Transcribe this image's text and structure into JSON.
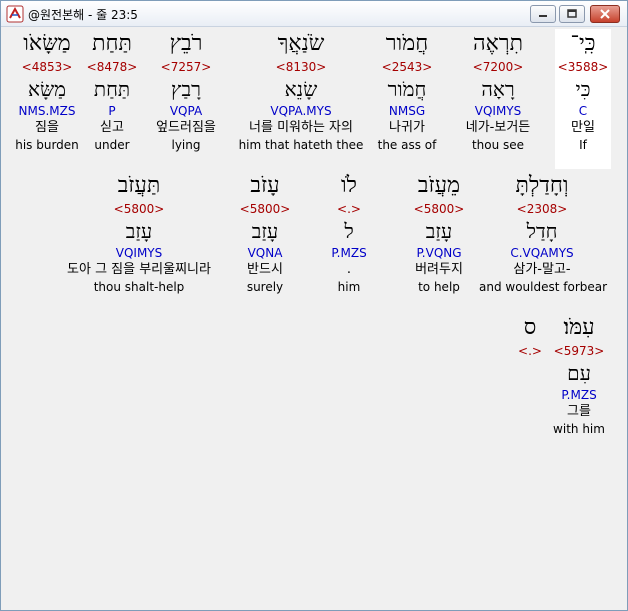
{
  "window": {
    "title": "@원전본해 - 줄 23:5"
  },
  "rows": [
    {
      "words": [
        {
          "hebrew": "כִּֽי־",
          "strongs": "<3588>",
          "root": "כִּי",
          "parse": "C",
          "korean": "만일",
          "english": "If",
          "highlight": true
        },
        {
          "hebrew": "תִרְאֶה",
          "strongs": "<7200>",
          "root": "רָאָה",
          "parse": "VQIMYS",
          "korean": "네가-보거든",
          "english": "thou see",
          "highlight": false
        },
        {
          "hebrew": "חֲמֹור",
          "strongs": "<2543>",
          "root": "חֲמֹור",
          "parse": "NMSG",
          "korean": "나귀가",
          "english": "the ass of",
          "highlight": false
        },
        {
          "hebrew": "שֹׂנַאֲךָ",
          "strongs": "<8130>",
          "root": "שָׂנֵא",
          "parse": "VQPA.MYS",
          "korean": "너를 미워하는 자의",
          "english": "him that hateth thee",
          "highlight": false
        },
        {
          "hebrew": "רֹבֵץ",
          "strongs": "<7257>",
          "root": "רָבַץ",
          "parse": "VQPA",
          "korean": "엎드러짐을",
          "english": "lying",
          "highlight": false
        },
        {
          "hebrew": "תַּחַת",
          "strongs": "<8478>",
          "root": "תַּחַת",
          "parse": "P",
          "korean": "싣고",
          "english": "under",
          "highlight": false
        },
        {
          "hebrew": "מַשָּׂאֹו",
          "strongs": "<4853>",
          "root": "מַשָּׂא",
          "parse": "NMS.MZS",
          "korean": "짐을",
          "english": "his burden",
          "highlight": false
        }
      ]
    },
    {
      "words": [
        {
          "hebrew": "וְחָדַלְתָּ",
          "strongs": "<2308>",
          "root": "חָדַל",
          "parse": "C.VQAMYS",
          "korean": "삼가-말고-",
          "english": "and wouldest forbear",
          "highlight": false
        },
        {
          "hebrew": "מֵעֲזֹב",
          "strongs": "<5800>",
          "root": "עָזַב",
          "parse": "P.VQNG",
          "korean": "버려두지",
          "english": "to help",
          "highlight": false
        },
        {
          "hebrew": "לֹו",
          "strongs": "<.>",
          "root": "ל",
          "parse": "P.MZS",
          "korean": ".",
          "english": "him",
          "highlight": false
        },
        {
          "hebrew": "עָזֹב",
          "strongs": "<5800>",
          "root": "עָזַב",
          "parse": "VQNA",
          "korean": "반드시",
          "english": "surely",
          "highlight": false
        },
        {
          "hebrew": "תַּעֲזֹב",
          "strongs": "<5800>",
          "root": "עָזַב",
          "parse": "VQIMYS",
          "korean": "도아 그 짐을 부리울찌니라",
          "english": "thou shalt-help",
          "highlight": false
        }
      ]
    },
    {
      "words": [
        {
          "hebrew": "עִמֹּו׃",
          "strongs": "<5973>",
          "root": "עִם",
          "parse": "P.MZS",
          "korean": "그를",
          "english": "with him",
          "highlight": false
        },
        {
          "hebrew": "ס",
          "strongs": "<.>",
          "root": "",
          "parse": "",
          "korean": "",
          "english": "",
          "highlight": false
        }
      ]
    }
  ]
}
